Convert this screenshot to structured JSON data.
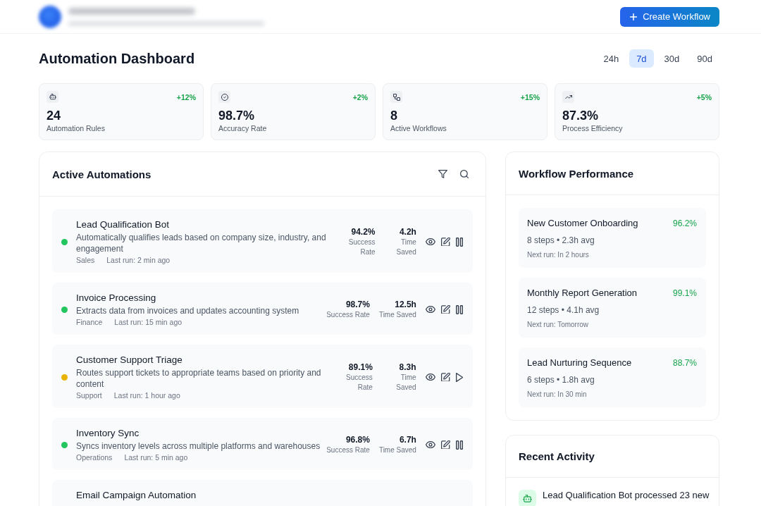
{
  "header": {
    "create_button": "Create Workflow"
  },
  "page_title": "Automation Dashboard",
  "time_ranges": [
    {
      "label": "24h",
      "selected": false
    },
    {
      "label": "7d",
      "selected": true
    },
    {
      "label": "30d",
      "selected": false
    },
    {
      "label": "90d",
      "selected": false
    }
  ],
  "stats": [
    {
      "change": "+12%",
      "value": "24",
      "label": "Automation Rules"
    },
    {
      "change": "+2%",
      "value": "98.7%",
      "label": "Accuracy Rate"
    },
    {
      "change": "+15%",
      "value": "8",
      "label": "Active Workflows"
    },
    {
      "change": "+5%",
      "value": "87.3%",
      "label": "Process Efficiency"
    }
  ],
  "active_automations": {
    "title": "Active Automations",
    "items": [
      {
        "name": "Lead Qualification Bot",
        "description": "Automatically qualifies leads based on company size, industry, and engagement",
        "category": "Sales",
        "last_run": "Last run: 2 min ago",
        "success_rate": "94.2%",
        "success_label": "Success Rate",
        "time_saved": "4.2h",
        "time_label": "Time Saved",
        "color": "#22c55e",
        "paused": false
      },
      {
        "name": "Invoice Processing",
        "description": "Extracts data from invoices and updates accounting system",
        "category": "Finance",
        "last_run": "Last run: 15 min ago",
        "success_rate": "98.7%",
        "success_label": "Success Rate",
        "time_saved": "12.5h",
        "time_label": "Time Saved",
        "color": "#22c55e",
        "paused": false
      },
      {
        "name": "Customer Support Triage",
        "description": "Routes support tickets to appropriate teams based on priority and content",
        "category": "Support",
        "last_run": "Last run: 1 hour ago",
        "success_rate": "89.1%",
        "success_label": "Success Rate",
        "time_saved": "8.3h",
        "time_label": "Time Saved",
        "color": "#eab308",
        "paused": true
      },
      {
        "name": "Inventory Sync",
        "description": "Syncs inventory levels across multiple platforms and warehouses",
        "category": "Operations",
        "last_run": "Last run: 5 min ago",
        "success_rate": "96.8%",
        "success_label": "Success Rate",
        "time_saved": "6.7h",
        "time_label": "Time Saved",
        "color": "#22c55e",
        "paused": false
      },
      {
        "name": "Email Campaign Automation"
      }
    ]
  },
  "workflow_performance": {
    "title": "Workflow Performance",
    "items": [
      {
        "name": "New Customer Onboarding",
        "rate": "96.2%",
        "details": "8 steps • 2.3h avg",
        "next_run": "Next run: In 2 hours"
      },
      {
        "name": "Monthly Report Generation",
        "rate": "99.1%",
        "details": "12 steps • 4.1h avg",
        "next_run": "Next run: Tomorrow"
      },
      {
        "name": "Lead Nurturing Sequence",
        "rate": "88.7%",
        "details": "6 steps • 1.8h avg",
        "next_run": "Next run: In 30 min"
      }
    ]
  },
  "recent_activity": {
    "title": "Recent Activity",
    "items": [
      {
        "text": "Lead Qualification Bot processed 23 new"
      }
    ]
  }
}
